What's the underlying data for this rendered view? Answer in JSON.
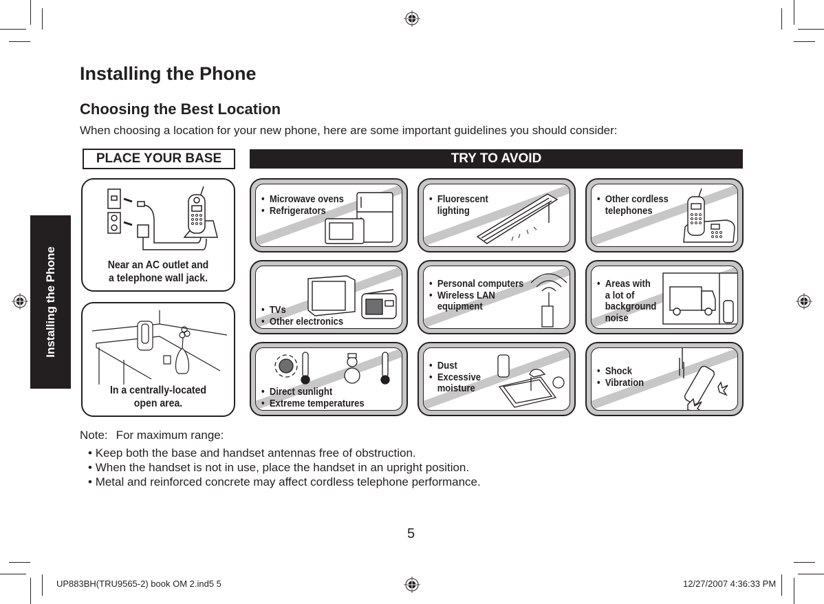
{
  "side_tab": {
    "label": "Installing the Phone"
  },
  "page": {
    "title": "Installing the Phone",
    "section_title": "Choosing the Best Location",
    "intro": "When choosing a location for your new phone, here are some important guidelines you should consider:"
  },
  "place_your_base": {
    "header": "PLACE YOUR BASE",
    "panels": [
      {
        "icon": "phone-base-wall-jack-illustration",
        "caption_lines": [
          "Near an AC outlet and",
          "a telephone wall jack."
        ]
      },
      {
        "icon": "phone-on-table-illustration",
        "caption_lines": [
          "In a centrally-located",
          "open area."
        ]
      }
    ]
  },
  "try_to_avoid": {
    "header": "TRY TO AVOID",
    "panels": [
      {
        "icon": "microwave-refrigerator-illustration",
        "items": [
          "Microwave ovens",
          "Refrigerators"
        ]
      },
      {
        "icon": "fluorescent-light-illustration",
        "items": [
          "Fluorescent"
        ],
        "continuation": [
          "lighting"
        ]
      },
      {
        "icon": "cordless-phone-illustration",
        "items": [
          "Other cordless"
        ],
        "continuation": [
          "telephones"
        ]
      },
      {
        "icon": "tv-radio-illustration",
        "items": [
          "TVs",
          "Other electronics"
        ]
      },
      {
        "icon": "wireless-router-illustration",
        "items": [
          "Personal computers",
          "Wireless LAN"
        ],
        "continuation": [
          "equipment"
        ]
      },
      {
        "icon": "truck-window-illustration",
        "items": [
          "Areas with"
        ],
        "continuation": [
          "a lot of",
          "background",
          "noise"
        ]
      },
      {
        "icon": "sun-thermometer-snowman-illustration",
        "items": [
          "Direct sunlight",
          "Extreme temperatures"
        ]
      },
      {
        "icon": "sink-water-illustration",
        "items": [
          "Dust",
          "Excessive"
        ],
        "continuation": [
          "moisture"
        ]
      },
      {
        "icon": "falling-phone-illustration",
        "items": [
          "Shock",
          "Vibration"
        ]
      }
    ]
  },
  "note": {
    "label": "Note:",
    "text": "For maximum range:",
    "bullets": [
      "Keep both the base and handset antennas free of obstruction.",
      "When the handset is not in use, place the handset in an upright position.",
      "Metal and reinforced concrete may affect cordless telephone performance."
    ]
  },
  "page_number": "5",
  "print_slug": {
    "file": "UP883BH(TRU9565-2) book OM 2.ind5   5",
    "timestamp": "12/27/2007   4:36:33 PM"
  },
  "colors": {
    "ink": "#231f20",
    "panel_gray": "#c8c7c7",
    "paper": "#ffffff"
  }
}
